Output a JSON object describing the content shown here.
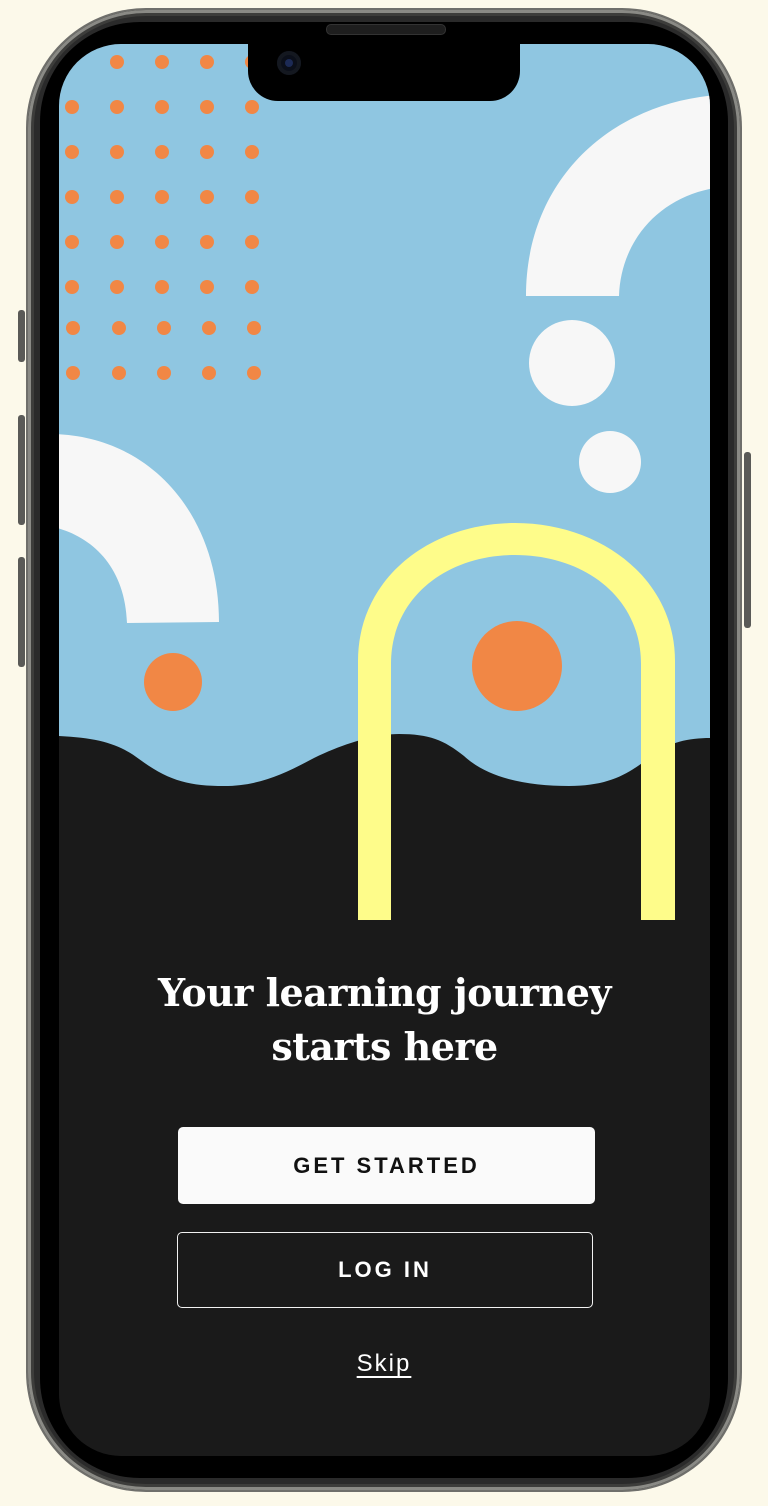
{
  "onboarding": {
    "headline_line1": "Your learning journey",
    "headline_line2": "starts here",
    "primary_button": "GET STARTED",
    "secondary_button": "LOG IN",
    "skip_link": "Skip"
  },
  "colors": {
    "page_background": "#fcf9ea",
    "sky": "#8fc6e1",
    "ground": "#1a1a1a",
    "dots": "#f18745",
    "arch": "#fefc8a",
    "white_shapes": "#f7f7f7"
  }
}
